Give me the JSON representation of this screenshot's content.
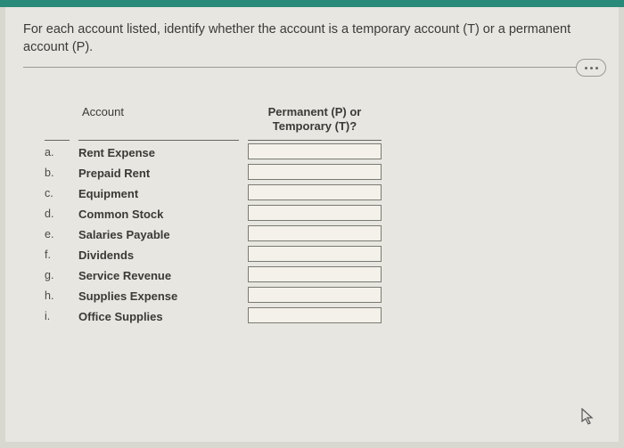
{
  "question": "For each account listed, identify whether the account is a temporary account (T) or a permanent account (P).",
  "headers": {
    "account": "Account",
    "type_line1": "Permanent (P) or",
    "type_line2": "Temporary (T)?"
  },
  "rows": [
    {
      "label": "a.",
      "account": "Rent Expense",
      "value": ""
    },
    {
      "label": "b.",
      "account": "Prepaid Rent",
      "value": ""
    },
    {
      "label": "c.",
      "account": "Equipment",
      "value": ""
    },
    {
      "label": "d.",
      "account": "Common Stock",
      "value": ""
    },
    {
      "label": "e.",
      "account": "Salaries Payable",
      "value": ""
    },
    {
      "label": "f.",
      "account": "Dividends",
      "value": ""
    },
    {
      "label": "g.",
      "account": "Service Revenue",
      "value": ""
    },
    {
      "label": "h.",
      "account": "Supplies Expense",
      "value": ""
    },
    {
      "label": "i.",
      "account": "Office Supplies",
      "value": ""
    }
  ]
}
